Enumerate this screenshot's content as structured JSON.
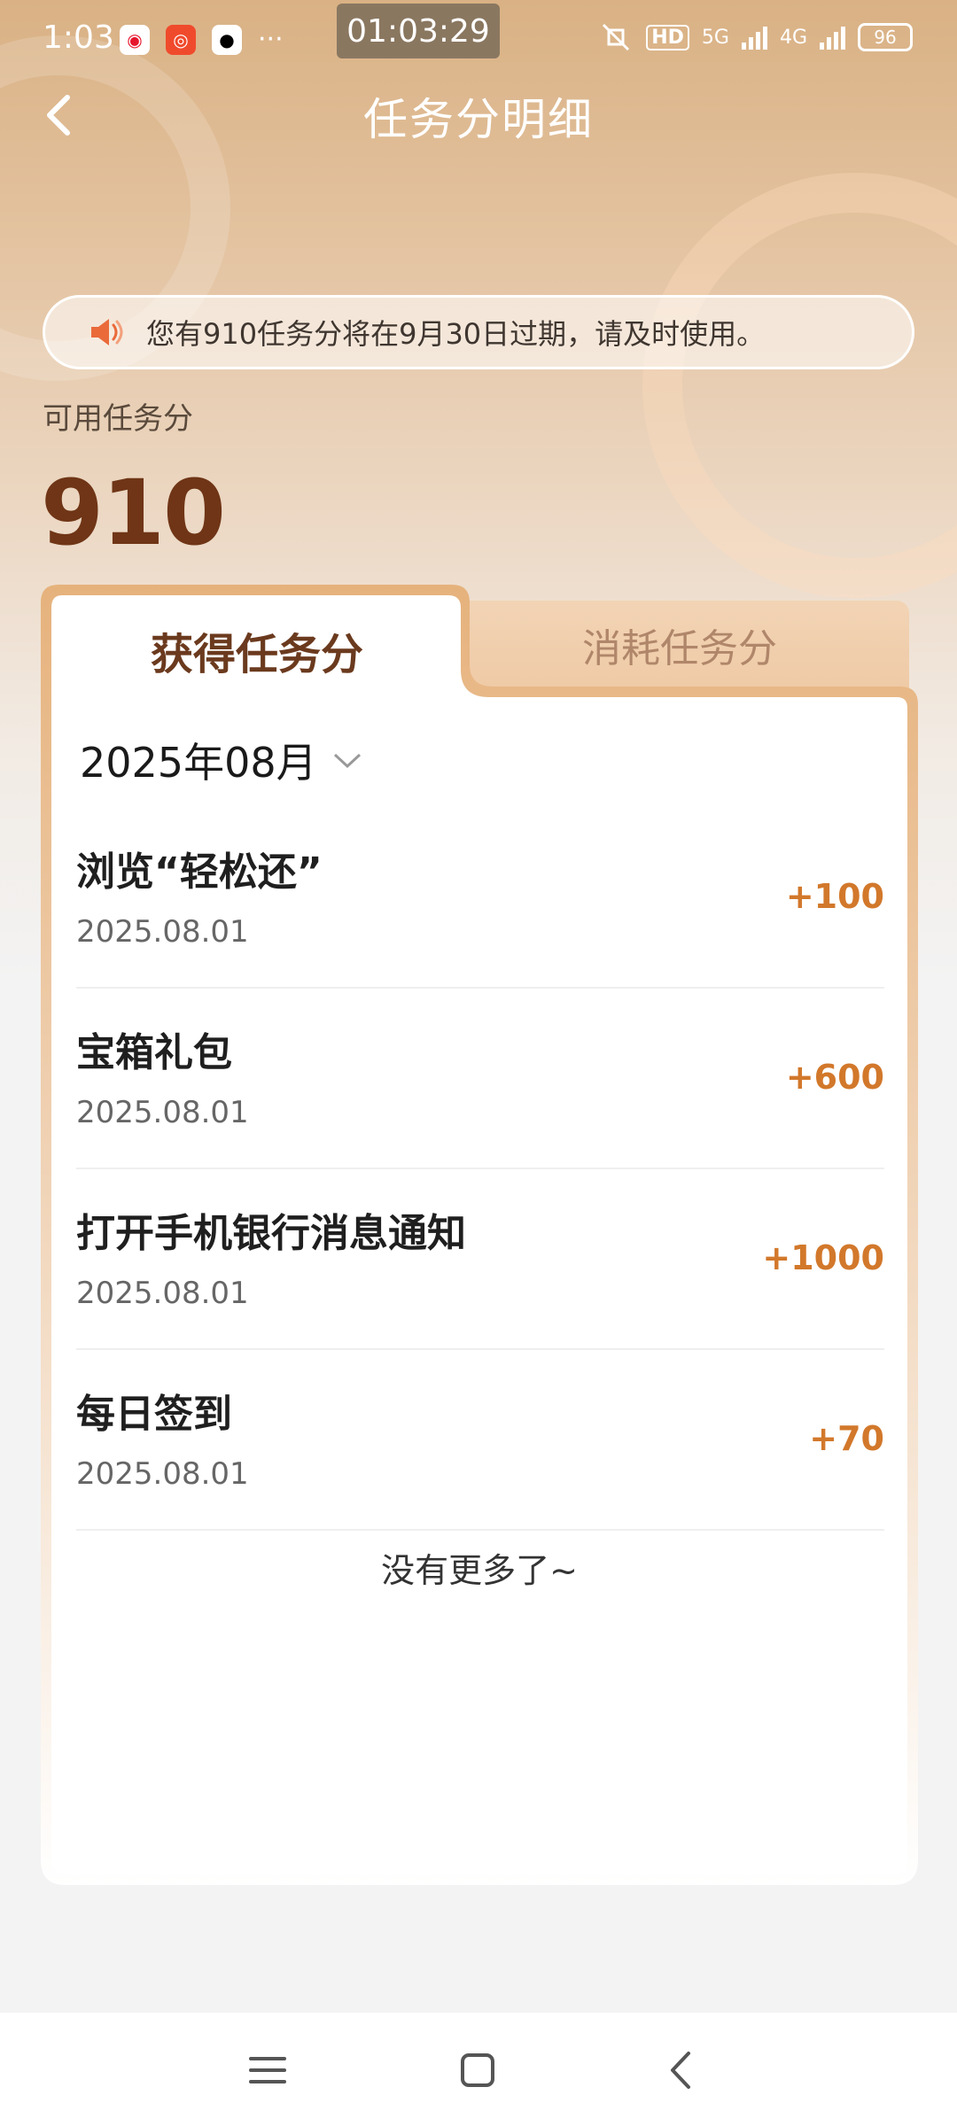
{
  "status_bar": {
    "time": "1:03",
    "recording_clock": "01:03:29",
    "network_hd": "HD",
    "net1": "5G",
    "net2": "4G",
    "battery": "96"
  },
  "header": {
    "title": "任务分明细"
  },
  "notice": {
    "text": "您有910任务分将在9月30日过期，请及时使用。"
  },
  "available": {
    "label": "可用任务分",
    "value": "910"
  },
  "tabs": [
    {
      "label": "获得任务分",
      "active": true
    },
    {
      "label": "消耗任务分",
      "active": false
    }
  ],
  "month_filter": {
    "value": "2025年08月"
  },
  "records": [
    {
      "name": "浏览“轻松还”",
      "date": "2025.08.01",
      "points": "+100"
    },
    {
      "name": "宝箱礼包",
      "date": "2025.08.01",
      "points": "+600"
    },
    {
      "name": "打开手机银行消息通知",
      "date": "2025.08.01",
      "points": "+1000"
    },
    {
      "name": "每日签到",
      "date": "2025.08.01",
      "points": "+70"
    }
  ],
  "list_end_text": "没有更多了~",
  "colors": {
    "accent": "#d2782b",
    "title_brown": "#6f3516",
    "tab_text": "#6b3a1e"
  }
}
